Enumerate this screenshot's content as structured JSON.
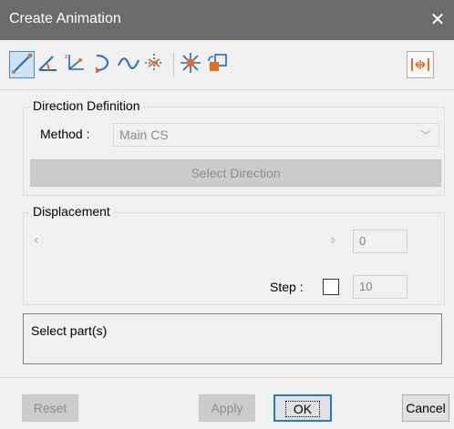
{
  "window": {
    "title": "Create Animation",
    "close_glyph": "✕"
  },
  "toolbar": {
    "icons": [
      "line-draw-icon",
      "angle-icon",
      "axis-xyz-icon",
      "curve-arrow-icon",
      "wave-icon",
      "split-arrows-icon",
      "explode-icon",
      "rotate-box-icon"
    ],
    "right_icon": "measure-distance-icon"
  },
  "direction": {
    "group_label": "Direction Definition",
    "method_label": "Method :",
    "method_value": "Main CS",
    "select_button": "Select Direction"
  },
  "displacement": {
    "group_label": "Displacement",
    "value": "0",
    "step_label": "Step :",
    "step_value": "10",
    "step_checked": false
  },
  "status_text": "Select part(s)",
  "footer": {
    "reset": "Reset",
    "apply": "Apply",
    "ok": "OK",
    "cancel": "Cancel"
  },
  "colors": {
    "titlebar": "#6b6b6b",
    "accent": "#1f7bd8",
    "icon_orange": "#e07020"
  }
}
